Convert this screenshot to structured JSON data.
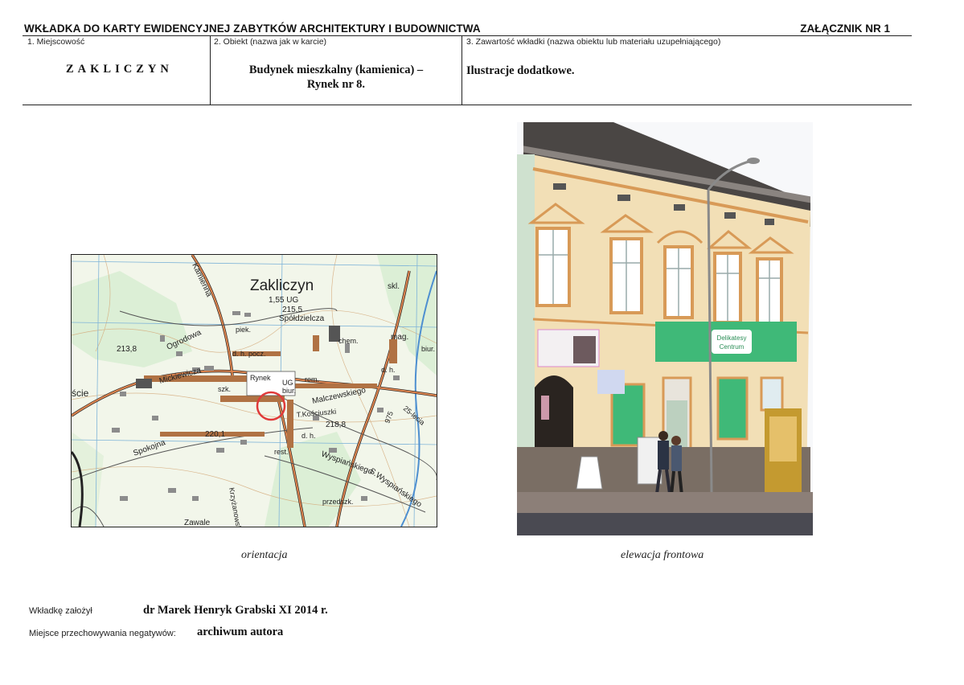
{
  "header": {
    "title": "WKŁADKA DO KARTY EWIDENCYJNEJ ZABYTKÓW ARCHITEKTURY I BUDOWNICTWA",
    "annex": "ZAŁĄCZNIK NR 1"
  },
  "columns": [
    {
      "label": "1. Miejscowość",
      "value": "ZAKLICZYN"
    },
    {
      "label": "2. Obiekt (nazwa jak w karcie)",
      "value_line1": "Budynek mieszkalny (kamienica) –",
      "value_line2": "Rynek nr 8."
    },
    {
      "label": "3. Zawartość wkładki (nazwa obiektu lub materiału uzupełniającego)",
      "value": "Ilustracje dodatkowe."
    }
  ],
  "map": {
    "caption": "orientacja",
    "labels": {
      "town": "Zakliczyn",
      "height_ug": "1,55 UG",
      "elev_215": "215,5",
      "spoldzielcza": "Spółdzielcza",
      "skl": "skl.",
      "piek": "piek.",
      "chem": "chem.",
      "mag": "mag.",
      "biur_top": "biur.",
      "dh_top": "d. h.",
      "dh_pocz": "d. h. pocz.",
      "elev_213": "213,8",
      "ogrodowa": "Ogrodowa",
      "kamienna": "Kamienna",
      "rynek": "Rynek",
      "ug": "UG",
      "rem": "rem.",
      "biur_mid": "biur.",
      "szk": "szk.",
      "mickiewicza": "Mickiewicza",
      "malczewskiego": "Malczewskiego",
      "kosciuszki": "T.Kościuszki",
      "elev_218": "218,8",
      "lecia": "25-lecia",
      "scie": "ście",
      "spokojna": "Spokojna",
      "elev_220": "220,1",
      "dh_bottom": "d. h.",
      "rest": "rest.",
      "wyspianskiego": "Wyspiańskiego",
      "s_wyspianskiego": "S.Wyspiańskiego",
      "przedszk": "przedszk.",
      "road_975": "975",
      "zawale": "Zawale",
      "krzyzanowskiego": "Krzyżanowskiego"
    }
  },
  "photo": {
    "caption": "elewacja frontowa",
    "shop_sign_line1": "Delikatesy",
    "shop_sign_line2": "Centrum"
  },
  "footer": {
    "founded_label": "Wkładkę założył",
    "founded_value": "dr Marek Henryk Grabski XI 2014 r.",
    "negatives_label": "Miejsce przechowywania negatywów:",
    "negatives_value": "archiwum autora"
  },
  "colors": {
    "map_road": "#d9824e",
    "map_marker": "#e03a3a",
    "facade": "#f2dfb6",
    "trim": "#d89a57",
    "shop_green": "#3fb978",
    "roof": "#4a4644"
  }
}
